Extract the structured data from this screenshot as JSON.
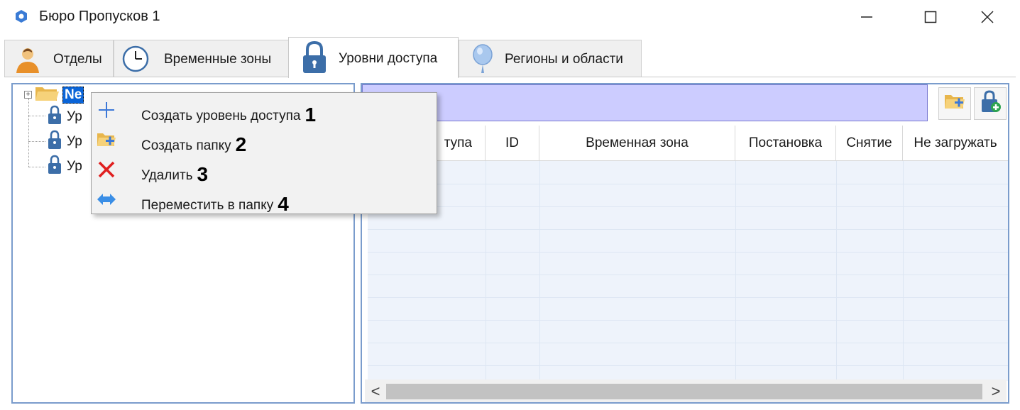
{
  "window": {
    "title": "Бюро Пропусков 1",
    "controls": {
      "minimize": "—",
      "maximize": "☐",
      "close": "✕"
    }
  },
  "tabs": [
    {
      "label": "Отделы",
      "icon": "person-icon",
      "active": false
    },
    {
      "label": "Временные зоны",
      "icon": "clock-icon",
      "active": false
    },
    {
      "label": "Уровни доступа",
      "icon": "padlock-icon",
      "active": true
    },
    {
      "label": "Регионы и области",
      "icon": "balloon-icon",
      "active": false
    }
  ],
  "tree": {
    "root": {
      "label": "Ne",
      "expander": "+"
    },
    "items": [
      {
        "label": "Ур"
      },
      {
        "label": "Ур"
      },
      {
        "label": "Ур"
      }
    ]
  },
  "toolbar": {
    "buttons": [
      {
        "icon": "add-folder-icon"
      },
      {
        "icon": "add-access-level-icon"
      }
    ]
  },
  "grid": {
    "columns": [
      "тупа",
      "ID",
      "Временная зона",
      "Постановка",
      "Снятие",
      "Не загружать"
    ],
    "scroll_left": "<",
    "scroll_right": ">"
  },
  "context_menu": {
    "items": [
      {
        "label": "Создать уровень доступа",
        "number": "1",
        "icon": "plus-icon"
      },
      {
        "label": "Создать папку",
        "number": "2",
        "icon": "add-folder-icon"
      },
      {
        "label": "Удалить",
        "number": "3",
        "icon": "delete-x-icon"
      },
      {
        "label": "Переместить в папку",
        "number": "4",
        "icon": "move-arrows-icon"
      }
    ]
  },
  "colors": {
    "selection": "#0a64d8",
    "toolbar_bg": "#ccccff",
    "panel_border": "#7a9ccc",
    "delete_red": "#e02020",
    "plus_blue": "#3c78d8"
  }
}
